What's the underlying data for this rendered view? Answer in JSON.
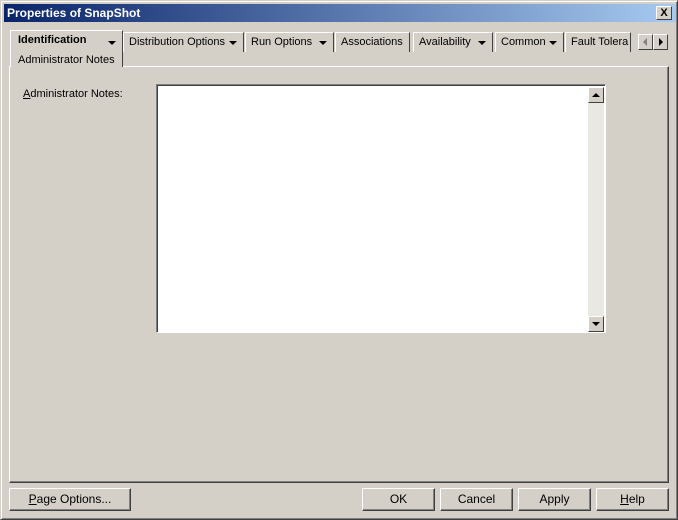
{
  "window": {
    "title": "Properties of SnapShot",
    "close": "X"
  },
  "tabs": [
    {
      "label": "Identification",
      "sub": "Administrator Notes"
    },
    {
      "label": "Distribution Options"
    },
    {
      "label": "Run Options"
    },
    {
      "label": "Associations"
    },
    {
      "label": "Availability"
    },
    {
      "label": "Common"
    },
    {
      "label": "Fault Tolera"
    }
  ],
  "form": {
    "notes_accel": "A",
    "notes_rest": "dministrator Notes:",
    "notes_value": ""
  },
  "buttons": {
    "page_options": {
      "accel": "P",
      "rest": "age Options..."
    },
    "ok": "OK",
    "cancel": "Cancel",
    "apply": "Apply",
    "help": {
      "accel": "H",
      "rest": "elp"
    }
  }
}
